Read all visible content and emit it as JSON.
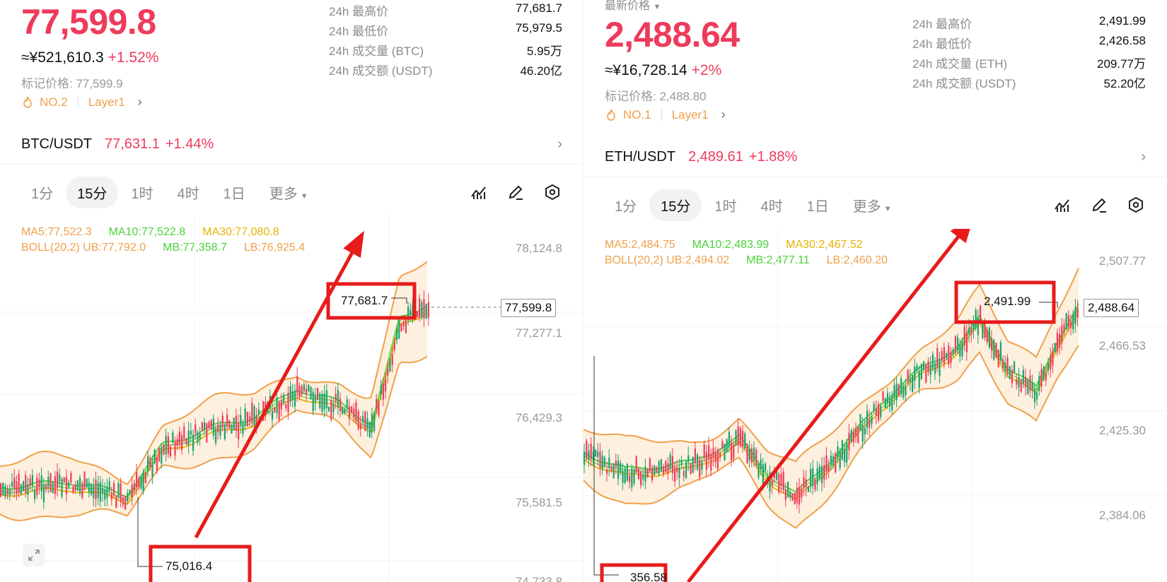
{
  "colors": {
    "up": "#ee3b5b",
    "down": "#1aa16f",
    "annotation": "#e81b1b",
    "boll_fill": "#fdf0de",
    "boll_line": "#f0a04b"
  },
  "left": {
    "price": "77,599.8",
    "cny": "≈¥521,610.3",
    "change": "+1.52%",
    "mark_price": "标记价格: 77,599.9",
    "rank": "NO.2",
    "tag": "Layer1",
    "stats": [
      {
        "label": "24h 最高价",
        "value": "77,681.7"
      },
      {
        "label": "24h 最低价",
        "value": "75,979.5"
      },
      {
        "label": "24h 成交量 (BTC)",
        "value": "5.95万"
      },
      {
        "label": "24h 成交额 (USDT)",
        "value": "46.20亿"
      }
    ],
    "pair": "BTC/USDT",
    "pair_price": "77,631.1",
    "pair_change": "+1.44%",
    "tabs": [
      "1分",
      "15分",
      "1时",
      "4时",
      "1日",
      "更多"
    ],
    "active_tab": 1,
    "ma5": "MA5:77,522.3",
    "ma10": "MA10:77,522.8",
    "ma30": "MA30:77,080.8",
    "boll": "BOLL(20,2) UB:77,792.0",
    "mb": "MB:77,358.7",
    "lb": "LB:76,925.4",
    "y_labels": [
      "78,124.8",
      "77,277.1",
      "76,429.3",
      "75,581.5",
      "74,733.8"
    ],
    "current_tag": "77,599.8",
    "high_label": "77,681.7",
    "low_label": "75,016.4"
  },
  "right": {
    "top_label": "最新价格",
    "price": "2,488.64",
    "cny": "≈¥16,728.14",
    "change": "+2%",
    "mark_price": "标记价格: 2,488.80",
    "rank": "NO.1",
    "tag": "Layer1",
    "stats": [
      {
        "label": "24h 最高价",
        "value": "2,491.99"
      },
      {
        "label": "24h 最低价",
        "value": "2,426.58"
      },
      {
        "label": "24h 成交量 (ETH)",
        "value": "209.77万"
      },
      {
        "label": "24h 成交额 (USDT)",
        "value": "52.20亿"
      }
    ],
    "pair": "ETH/USDT",
    "pair_price": "2,489.61",
    "pair_change": "+1.88%",
    "tabs": [
      "1分",
      "15分",
      "1时",
      "4时",
      "1日",
      "更多"
    ],
    "active_tab": 1,
    "ma5": "MA5:2,484.75",
    "ma10": "MA10:2,483.99",
    "ma30": "MA30:2,467.52",
    "boll": "BOLL(20,2) UB:2,494.02",
    "mb": "MB:2,477.11",
    "lb": "LB:2,460.20",
    "y_labels": [
      "2,507.77",
      "2,466.53",
      "2,425.30",
      "2,384.06"
    ],
    "current_tag": "2,488.64",
    "high_label": "2,491.99",
    "low_label": "356.58"
  }
}
